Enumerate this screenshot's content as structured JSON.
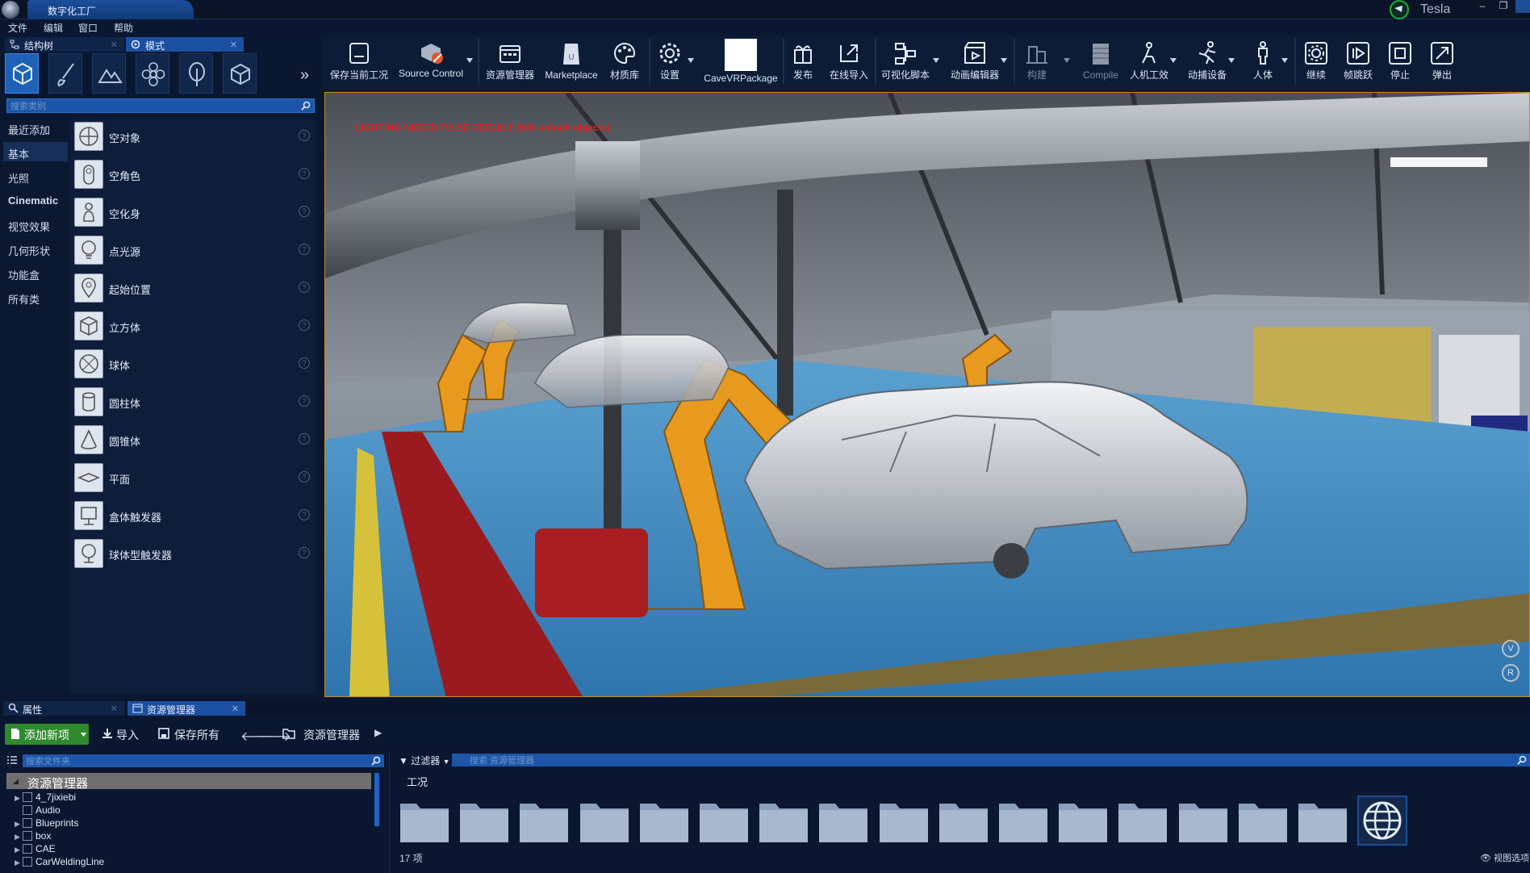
{
  "titlebar": {
    "window_title": "数字化工厂",
    "user_name": "Tesla",
    "minimize": "–",
    "maximize": "❐"
  },
  "menu": [
    "文件",
    "编辑",
    "窗口",
    "帮助"
  ],
  "left_panel": {
    "tabs": [
      {
        "label": "结构树",
        "icon": "hierarchy-icon"
      },
      {
        "label": "模式",
        "icon": "mode-icon"
      }
    ],
    "search_placeholder": "搜索类别",
    "categories": [
      "最近添加",
      "基本",
      "光照",
      "Cinematic",
      "视觉效果",
      "几何形状",
      "功能盒",
      "所有类"
    ],
    "place_items": [
      {
        "label": "空对象",
        "icon": "empty-actor-icon"
      },
      {
        "label": "空角色",
        "icon": "empty-character-icon"
      },
      {
        "label": "空化身",
        "icon": "empty-pawn-icon"
      },
      {
        "label": "点光源",
        "icon": "point-light-icon"
      },
      {
        "label": "起始位置",
        "icon": "player-start-icon"
      },
      {
        "label": "立方体",
        "icon": "cube-icon"
      },
      {
        "label": "球体",
        "icon": "sphere-icon"
      },
      {
        "label": "圆柱体",
        "icon": "cylinder-icon"
      },
      {
        "label": "圆锥体",
        "icon": "cone-icon"
      },
      {
        "label": "平面",
        "icon": "plane-icon"
      },
      {
        "label": "盒体触发器",
        "icon": "box-trigger-icon"
      },
      {
        "label": "球体型触发器",
        "icon": "sphere-trigger-icon"
      }
    ]
  },
  "toolbar": {
    "buttons": [
      {
        "label": "保存当前工况",
        "icon": "save-icon"
      },
      {
        "label": "Source Control",
        "icon": "source-control-icon"
      },
      {
        "label": "资源管理器",
        "icon": "content-browser-icon"
      },
      {
        "label": "Marketplace",
        "icon": "marketplace-icon"
      },
      {
        "label": "材质库",
        "icon": "material-palette-icon"
      },
      {
        "label": "设置",
        "icon": "settings-gear-icon"
      },
      {
        "label": "CaveVRPackage",
        "icon": "cave-vr-package-icon"
      },
      {
        "label": "发布",
        "icon": "publish-gift-icon"
      },
      {
        "label": "在线导入",
        "icon": "online-import-icon"
      },
      {
        "label": "可视化脚本",
        "icon": "visual-script-icon"
      },
      {
        "label": "动画编辑器",
        "icon": "animation-editor-icon"
      },
      {
        "label": "构建",
        "icon": "build-icon"
      },
      {
        "label": "Compile",
        "icon": "compile-icon"
      },
      {
        "label": "人机工效",
        "icon": "ergonomics-icon"
      },
      {
        "label": "动捕设备",
        "icon": "motion-capture-icon"
      },
      {
        "label": "人体",
        "icon": "human-body-icon"
      },
      {
        "label": "继续",
        "icon": "continue-icon"
      },
      {
        "label": "帧跳跃",
        "icon": "frame-skip-icon"
      },
      {
        "label": "停止",
        "icon": "stop-icon"
      },
      {
        "label": "弹出",
        "icon": "eject-icon"
      }
    ]
  },
  "viewport": {
    "warning": "LIGHTING NEEDS TO BE REBUILT (606 unbuilt objects)",
    "gizmo": [
      "V",
      "R"
    ]
  },
  "bottom": {
    "tabs": [
      {
        "label": "属性",
        "icon": "properties-search-icon"
      },
      {
        "label": "资源管理器",
        "icon": "content-browser-tab-icon"
      }
    ],
    "add_new": "添加新项",
    "import": "导入",
    "save_all": "保存所有",
    "path": "资源管理器",
    "folder_search_placeholder": "搜索文件夹",
    "filter": "过滤器",
    "asset_search_placeholder": "搜索 资源管理器",
    "tree_root": "资源管理器",
    "tree_items": [
      "4_7jixiebi",
      "Audio",
      "Blueprints",
      "box",
      "CAE",
      "CarWeldingLine"
    ],
    "current_folder": "工况",
    "item_count": "17 项",
    "view_options": "视图选项"
  },
  "colors": {
    "accent_blue": "#1d62b8",
    "add_green": "#2f8a2e",
    "viewport_border": "#c98a1c",
    "warning_red": "#e12020"
  }
}
